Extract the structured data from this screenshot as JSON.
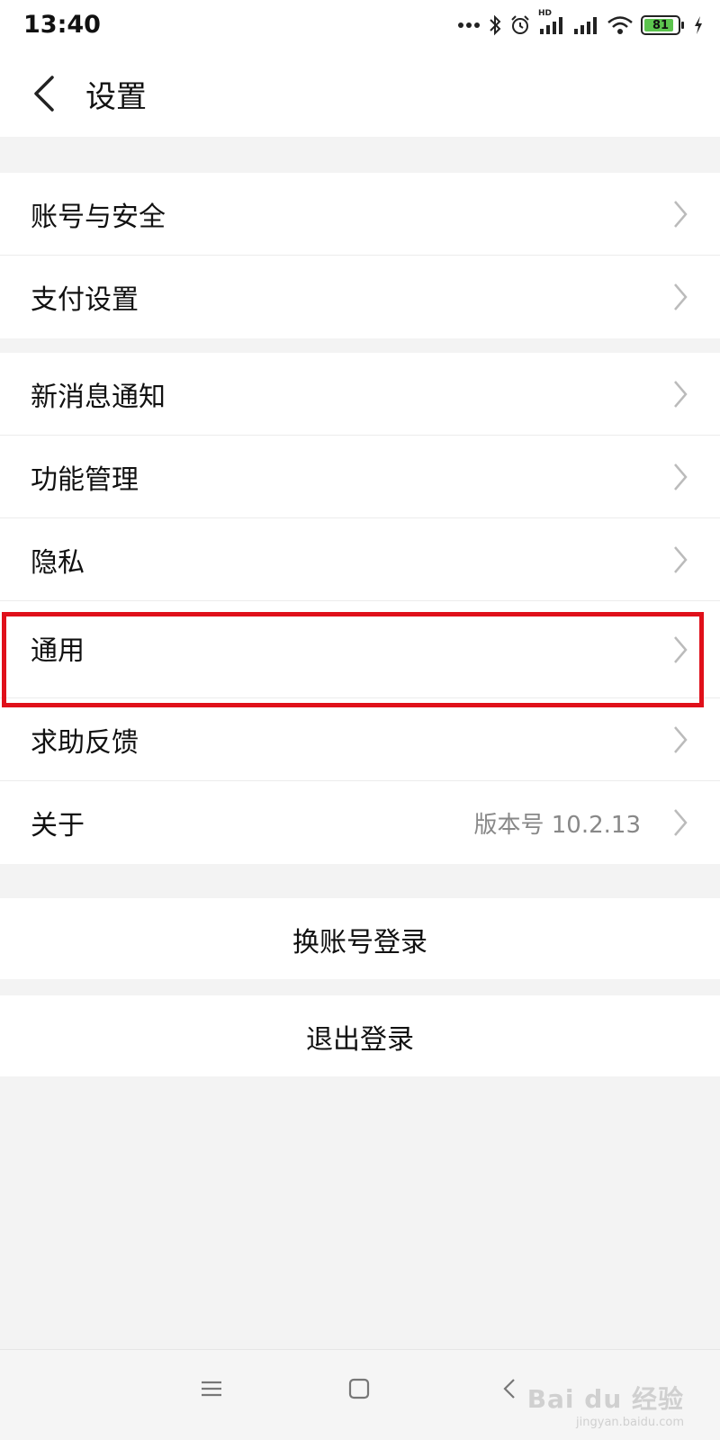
{
  "status_bar": {
    "time": "13:40",
    "icons": [
      "more-dots-icon",
      "bluetooth-icon",
      "alarm-icon",
      "hd-signal-icon",
      "signal-icon",
      "wifi-icon",
      "battery-icon",
      "charging-icon"
    ],
    "hd_label": "HD",
    "battery_level": "81"
  },
  "header": {
    "title": "设置",
    "back_icon": "back-chevron-icon"
  },
  "groups": [
    [
      {
        "label": "账号与安全"
      },
      {
        "label": "支付设置"
      }
    ],
    [
      {
        "label": "新消息通知"
      },
      {
        "label": "功能管理"
      },
      {
        "label": "隐私"
      },
      {
        "label": "通用"
      },
      {
        "label": "求助反馈"
      },
      {
        "label": "关于",
        "value": "版本号 10.2.13"
      }
    ]
  ],
  "highlight_color": "#e0101a",
  "actions": {
    "switch_account": "换账号登录",
    "logout": "退出登录"
  },
  "nav_bar": {
    "icons": [
      "menu-icon",
      "home-square-icon",
      "back-triangle-icon"
    ]
  },
  "watermark": {
    "main": "Bai du 经验",
    "sub": "jingyan.baidu.com"
  }
}
